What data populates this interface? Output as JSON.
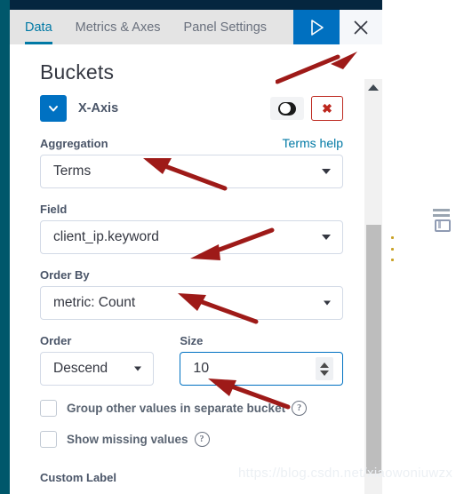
{
  "window": {
    "accent_blue": "#0071c2",
    "link_blue": "#0079a5",
    "danger_red": "#bd271e",
    "rail_teal": "#00576b",
    "header_navy": "#05263f"
  },
  "tabs": [
    {
      "label": "Data",
      "active": true
    },
    {
      "label": "Metrics & Axes",
      "active": false
    },
    {
      "label": "Panel Settings",
      "active": false
    }
  ],
  "tab_actions": {
    "apply_icon": "play-triangle-icon",
    "apply_title": "Apply changes",
    "close_icon": "close-x-icon",
    "close_title": "Close"
  },
  "panel": {
    "section_title": "Buckets",
    "bucket": {
      "collapse_icon": "chevron-down-icon",
      "title": "X-Axis",
      "toggle_icon": "toggle-switch-on-icon",
      "delete_icon": "red-x-icon",
      "delete_label": "✖"
    },
    "aggregation": {
      "label": "Aggregation",
      "help_link": "Terms help",
      "value": "Terms"
    },
    "field": {
      "label": "Field",
      "value": "client_ip.keyword"
    },
    "order_by": {
      "label": "Order By",
      "value": "metric: Count"
    },
    "order": {
      "label": "Order",
      "value": "Descend"
    },
    "size": {
      "label": "Size",
      "value": "10",
      "placeholder": "Size"
    },
    "checkboxes": [
      {
        "label": "Group other values in separate bucket",
        "checked": false,
        "help": "?"
      },
      {
        "label": "Show missing values",
        "checked": false,
        "help": "?"
      }
    ],
    "custom_label": "Custom Label"
  },
  "scrollbar": {
    "up_arrow_icon": "scroll-up-arrow-icon"
  },
  "canvas": {
    "legend_icon": "mini-chart-legend-icon"
  },
  "watermark": "https://blog.csdn.net/xiaowoniuwzx"
}
